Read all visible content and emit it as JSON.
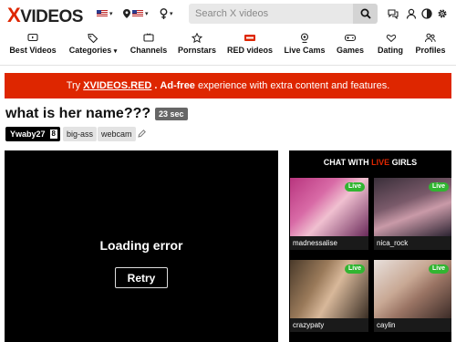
{
  "header": {
    "logo_x": "X",
    "logo_rest": "VIDEOS",
    "search_placeholder": "Search X videos"
  },
  "categories": [
    {
      "label": "Best Videos",
      "icon": "tv-icon"
    },
    {
      "label": "Categories",
      "icon": "tags-icon",
      "caret": "▾"
    },
    {
      "label": "Channels",
      "icon": "monitor-icon"
    },
    {
      "label": "Pornstars",
      "icon": "star-icon"
    },
    {
      "label": "RED videos",
      "icon": "red-badge-icon"
    },
    {
      "label": "Live Cams",
      "icon": "webcam-icon"
    },
    {
      "label": "Games",
      "icon": "gamepad-icon"
    },
    {
      "label": "Dating",
      "icon": "hearts-icon"
    },
    {
      "label": "Profiles",
      "icon": "users-icon"
    }
  ],
  "promo": {
    "pre": "Try",
    "brand": "XVIDEOS.RED",
    "adfree": "Ad-free",
    "rest": "experience with extra content and features."
  },
  "video": {
    "title": "what is her name???",
    "duration": "23 sec",
    "uploader": "Ywaby27",
    "uploader_count": "8",
    "tags": [
      "big-ass",
      "webcam"
    ]
  },
  "player": {
    "error": "Loading error",
    "retry": "Retry"
  },
  "live": {
    "head_pre": "CHAT WITH",
    "head_live": "LIVE",
    "head_post": "GIRLS",
    "badge": "Live",
    "cams": [
      {
        "name": "madnessalise"
      },
      {
        "name": "nica_rock"
      },
      {
        "name": "crazypaty"
      },
      {
        "name": "caylin"
      }
    ]
  },
  "colors": {
    "brand_red": "#de2600",
    "live_green": "#31b531"
  }
}
